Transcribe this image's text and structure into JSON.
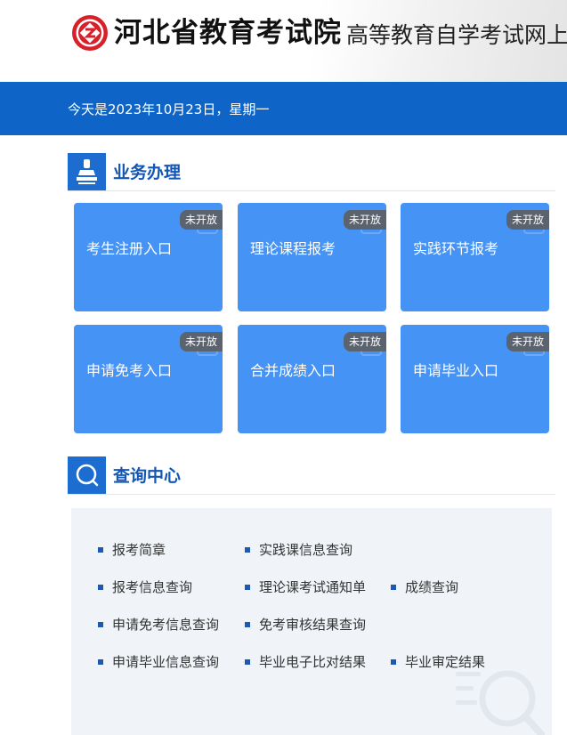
{
  "header": {
    "logo_icon": "exam-institute-seal-icon",
    "org_name": "河北省教育考试院",
    "site_name": "高等教育自学考试网上"
  },
  "date_bar": {
    "text": "今天是2023年10月23日，星期一"
  },
  "business": {
    "title": "业务办理",
    "icon": "stamp-icon",
    "badge": "未开放",
    "cards": [
      {
        "label": "考生注册入口"
      },
      {
        "label": "理论课程报考"
      },
      {
        "label": "实践环节报考"
      },
      {
        "label": "申请免考入口"
      },
      {
        "label": "合并成绩入口"
      },
      {
        "label": "申请毕业入口"
      }
    ]
  },
  "query": {
    "title": "查询中心",
    "icon": "search-icon",
    "items": [
      {
        "label": "报考简章"
      },
      {
        "label": "实践课信息查询"
      },
      {
        "label": "报考信息查询"
      },
      {
        "label": "理论课考试通知单"
      },
      {
        "label": "成绩查询"
      },
      {
        "label": "申请免考信息查询"
      },
      {
        "label": "免考审核结果查询"
      },
      {
        "label": "申请毕业信息查询"
      },
      {
        "label": "毕业电子比对结果"
      },
      {
        "label": "毕业审定结果"
      }
    ]
  },
  "colors": {
    "brand_blue": "#0f65c7",
    "card_blue": "#4593f5",
    "title_blue": "#1257b4",
    "logo_red": "#d7202a"
  }
}
